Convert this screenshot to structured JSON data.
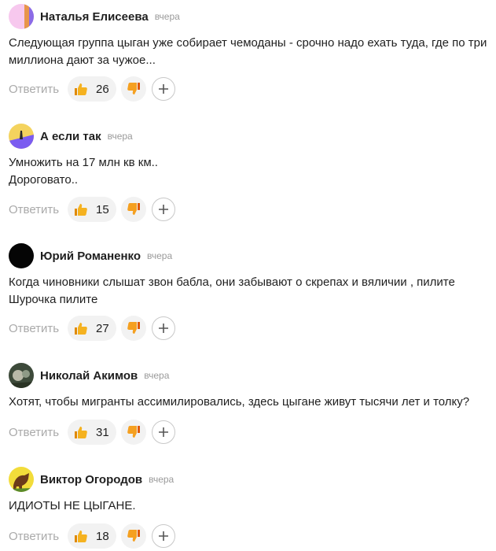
{
  "colors": {
    "like_bg": "#f2f2f2",
    "reply": "#aaaaaa",
    "time": "#9a9a9a"
  },
  "icons": {
    "like": "thumbs-up-icon",
    "dislike": "thumbs-down-icon",
    "add": "plus-icon"
  },
  "comments": [
    {
      "author": "Наталья Елисеева",
      "time": "вчера",
      "text": "Следующая группа цыган уже собирает чемоданы - срочно надо ехать туда, где по три миллиона дают за чужое...",
      "reply": "Ответить",
      "likes": "26"
    },
    {
      "author": "А если так",
      "time": "вчера",
      "text": "Умножить на 17 млн кв км..\nДороговато..",
      "reply": "Ответить",
      "likes": "15"
    },
    {
      "author": "Юрий Романенко",
      "time": "вчера",
      "text": "Когда чиновники слышат звон бабла, они забывают о скрепах и вяличии , пилите Шурочка пилите",
      "reply": "Ответить",
      "likes": "27"
    },
    {
      "author": "Николай Акимов",
      "time": "вчера",
      "text": "Хотят, чтобы мигранты ассимилировались, здесь цыгане живут тысячи лет и толку?",
      "reply": "Ответить",
      "likes": "31"
    },
    {
      "author": "Виктор Огородов",
      "time": "вчера",
      "text": "ИДИОТЫ НЕ ЦЫГАНЕ.",
      "reply": "Ответить",
      "likes": "18"
    }
  ]
}
